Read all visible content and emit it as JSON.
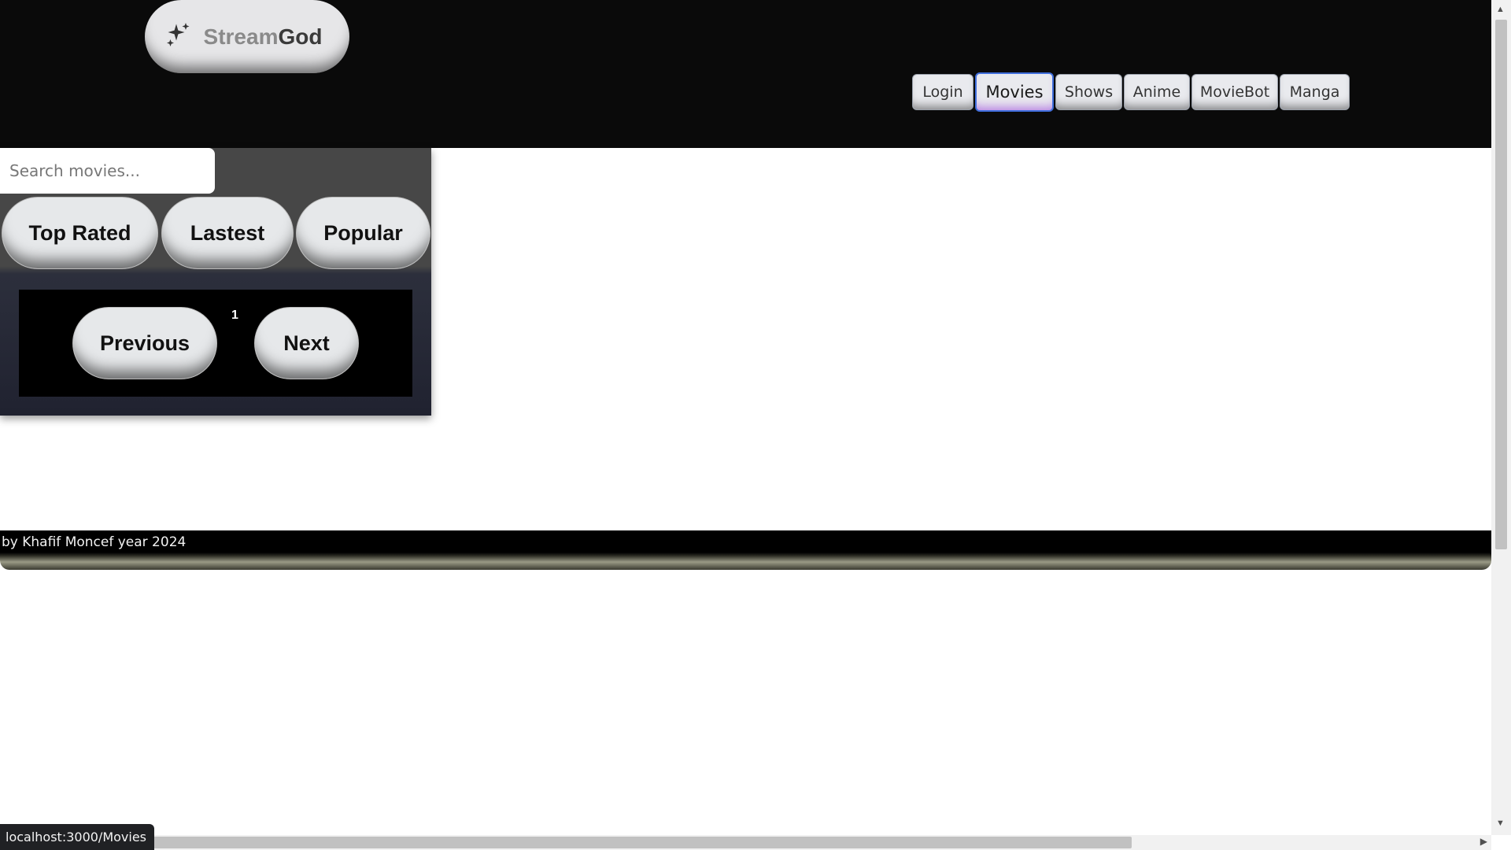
{
  "header": {
    "logo": {
      "part1": "Stream",
      "part2": "God",
      "icon": "sparkles-icon"
    },
    "nav": [
      {
        "label": "Login",
        "active": false
      },
      {
        "label": "Movies",
        "active": true
      },
      {
        "label": "Shows",
        "active": false
      },
      {
        "label": "Anime",
        "active": false
      },
      {
        "label": "MovieBot",
        "active": false
      },
      {
        "label": "Manga",
        "active": false
      }
    ]
  },
  "panel": {
    "search_placeholder": "Search movies...",
    "filters": [
      "Top Rated",
      "Lastest",
      "Popular"
    ],
    "pagination": {
      "previous": "Previous",
      "page": "1",
      "next": "Next"
    }
  },
  "footer": {
    "text": "by Khafif Moncef year 2024"
  },
  "status_bar": {
    "url": "localhost:3000/Movies"
  },
  "colors": {
    "header_bg": "#0a0a0a",
    "active_border": "#3f6edc",
    "pill_bg": "#e6e8ea"
  }
}
